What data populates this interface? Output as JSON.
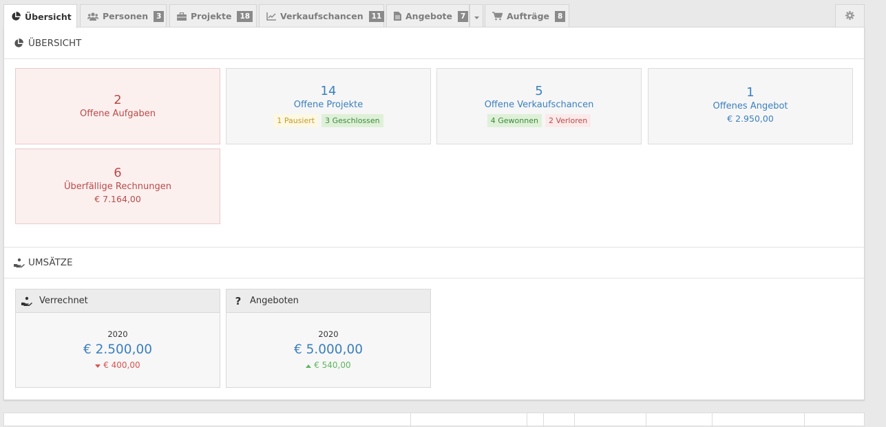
{
  "tabs": [
    {
      "label": "Übersicht",
      "icon": "pie-chart-icon",
      "active": true
    },
    {
      "label": "Personen",
      "icon": "users-icon",
      "count": "3"
    },
    {
      "label": "Projekte",
      "icon": "briefcase-icon",
      "count": "18"
    },
    {
      "label": "Verkaufschancen",
      "icon": "line-chart-icon",
      "count": "11"
    },
    {
      "label": "Angebote",
      "icon": "document-icon",
      "count": "7"
    },
    {
      "label": "Aufträge",
      "icon": "cart-icon",
      "count": "8"
    }
  ],
  "overview": {
    "title": "ÜBERSICHT",
    "cards": {
      "tasks": {
        "num": "2",
        "label": "Offene Aufgaben"
      },
      "projects": {
        "num": "14",
        "label": "Offene Projekte",
        "paused": "1 Pausiert",
        "closed": "3 Geschlossen"
      },
      "opportunities": {
        "num": "5",
        "label": "Offene Verkaufschancen",
        "won": "4 Gewonnen",
        "lost": "2 Verloren"
      },
      "offer": {
        "num": "1",
        "label": "Offenes Angebot",
        "amount": "€ 2.950,00"
      },
      "invoices": {
        "num": "6",
        "label": "Überfällige Rechnungen",
        "amount": "€ 7.164,00"
      }
    }
  },
  "revenue": {
    "title": "UMSÄTZE",
    "billed": {
      "title": "Verrechnet",
      "year": "2020",
      "amount": "€ 2.500,00",
      "delta": "€ 400,00",
      "trend": "down"
    },
    "offered": {
      "title": "Angeboten",
      "year": "2020",
      "amount": "€ 5.000,00",
      "delta": "€ 540,00",
      "trend": "up"
    }
  },
  "colors": {
    "accent": "#3a7fbf",
    "danger": "#b94a48",
    "success": "#5cb85c"
  }
}
